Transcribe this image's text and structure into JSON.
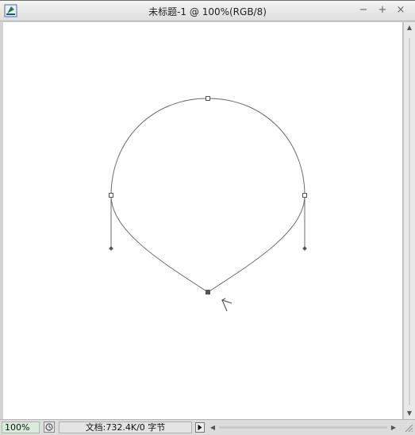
{
  "window": {
    "title": "未标题-1 @ 100%(RGB/8)",
    "minimize_glyph": "−",
    "maximize_glyph": "+",
    "close_glyph": "×"
  },
  "statusbar": {
    "zoom": "100%",
    "doc_info": "文档:732.4K/0 字节"
  },
  "icons": {
    "app": "photoshop-document-icon",
    "status": "status-info-icon",
    "menu_arrow": "triangle-right-icon",
    "cursor": "pen-tool-cursor-icon"
  },
  "colors": {
    "canvas": "#ffffff",
    "path": "#6a6a6a",
    "zoom_field": "#d9ecd9"
  }
}
